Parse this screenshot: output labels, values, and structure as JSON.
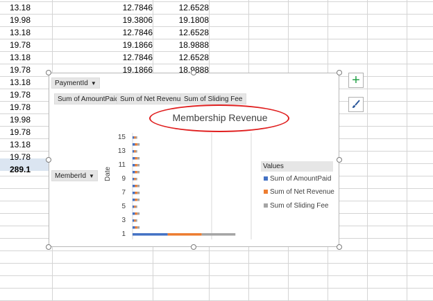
{
  "spreadsheet": {
    "rows": [
      [
        "13.18",
        "12.7846",
        "12.6528"
      ],
      [
        "19.98",
        "19.3806",
        "19.1808"
      ],
      [
        "13.18",
        "12.7846",
        "12.6528"
      ],
      [
        "19.78",
        "19.1866",
        "18.9888"
      ],
      [
        "13.18",
        "12.7846",
        "12.6528"
      ],
      [
        "19.78",
        "19.1866",
        "18.9888"
      ],
      [
        "13.18",
        "",
        ""
      ],
      [
        "19.78",
        "",
        ""
      ],
      [
        "19.78",
        "",
        ""
      ],
      [
        "19.98",
        "",
        ""
      ],
      [
        "19.78",
        "",
        ""
      ],
      [
        "13.18",
        "",
        ""
      ],
      [
        "19.78",
        "",
        ""
      ],
      [
        "289.1",
        "",
        ""
      ]
    ]
  },
  "pivot_chart": {
    "filter_field": "PaymentId",
    "value_fields": [
      "Sum of AmountPaid",
      "Sum of Net Revenue",
      "Sum of Sliding Fee"
    ],
    "row_field": "MemberId",
    "axis_field": "Date",
    "legend_title": "Values",
    "dropdown_glyph": "▼",
    "side_buttons": {
      "add": "+",
      "style": "brush-icon"
    }
  },
  "colors": {
    "amount_paid": "#4472c4",
    "net_revenue": "#ed7d31",
    "sliding_fee": "#a5a5a5",
    "annotation": "#e01f1f"
  },
  "chart_data": {
    "type": "bar",
    "orientation": "horizontal",
    "stacked": true,
    "title": "Membership Revenue",
    "xlabel": "",
    "ylabel": "Date",
    "y_tick_labels": [
      "1",
      "3",
      "5",
      "7",
      "9",
      "11",
      "13",
      "15"
    ],
    "categories": [
      "1",
      "2",
      "3",
      "4",
      "5",
      "6",
      "7",
      "8",
      "9",
      "10",
      "11",
      "12",
      "13",
      "14",
      "15"
    ],
    "series": [
      {
        "name": "Sum of AmountPaid",
        "values": [
          289.1,
          19.78,
          13.18,
          19.78,
          13.18,
          19.78,
          19.98,
          19.78,
          13.18,
          19.78,
          19.78,
          19.78,
          13.18,
          19.98,
          13.18
        ]
      },
      {
        "name": "Sum of Net Revenue",
        "values": [
          280.4,
          19.19,
          12.78,
          19.19,
          12.78,
          19.19,
          19.38,
          19.19,
          12.78,
          19.19,
          19.19,
          19.19,
          12.78,
          19.38,
          12.78
        ]
      },
      {
        "name": "Sum of Sliding Fee",
        "values": [
          277.5,
          18.99,
          12.65,
          18.99,
          12.65,
          18.99,
          19.18,
          18.99,
          12.65,
          18.99,
          18.99,
          18.99,
          12.65,
          19.18,
          12.65
        ]
      }
    ],
    "xlim": [
      0,
      1000
    ],
    "legend": "right",
    "grid": true
  }
}
